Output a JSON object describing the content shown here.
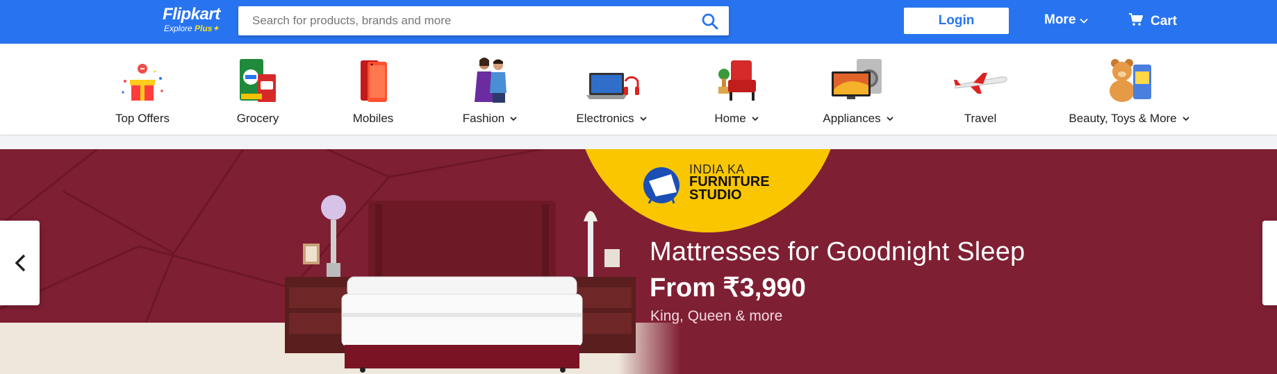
{
  "header": {
    "logo_main": "Flipkart",
    "logo_sub": "Explore",
    "logo_plus": "Plus",
    "search_placeholder": "Search for products, brands and more",
    "login_label": "Login",
    "more_label": "More",
    "cart_label": "Cart",
    "brand_color": "#2874f0"
  },
  "categories": [
    {
      "label": "Top Offers",
      "icon": "gift-icon",
      "has_dropdown": false
    },
    {
      "label": "Grocery",
      "icon": "grocery-icon",
      "has_dropdown": false
    },
    {
      "label": "Mobiles",
      "icon": "mobile-icon",
      "has_dropdown": false
    },
    {
      "label": "Fashion",
      "icon": "fashion-icon",
      "has_dropdown": true
    },
    {
      "label": "Electronics",
      "icon": "laptop-icon",
      "has_dropdown": true
    },
    {
      "label": "Home",
      "icon": "armchair-icon",
      "has_dropdown": true
    },
    {
      "label": "Appliances",
      "icon": "tv-icon",
      "has_dropdown": true
    },
    {
      "label": "Travel",
      "icon": "airplane-icon",
      "has_dropdown": false
    },
    {
      "label": "Beauty, Toys & More",
      "icon": "teddy-bear-icon",
      "has_dropdown": true
    }
  ],
  "banner": {
    "promo_line1": "INDIA KA",
    "promo_line2": "FURNITURE",
    "promo_line3": "STUDIO",
    "title": "Mattresses for Goodnight Sleep",
    "price": "From ₹3,990",
    "subtitle": "King, Queen & more",
    "bg_color": "#7f1f33",
    "accent_color": "#f9c600"
  }
}
